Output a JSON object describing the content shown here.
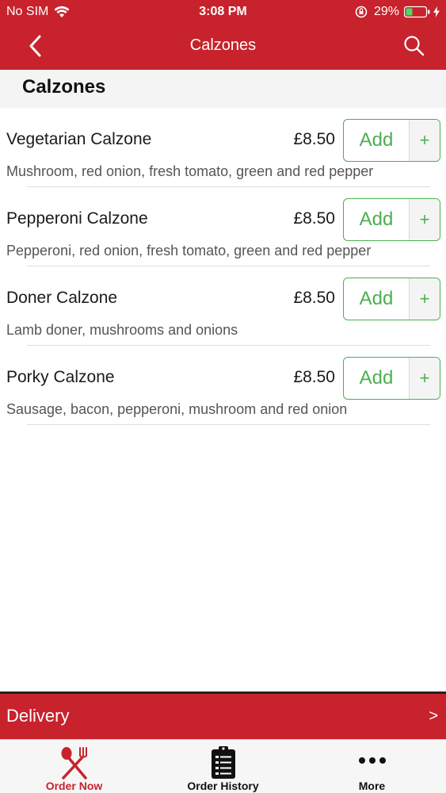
{
  "status_bar": {
    "carrier": "No SIM",
    "time": "3:08 PM",
    "battery": "29%"
  },
  "nav": {
    "title": "Calzones"
  },
  "section": {
    "title": "Calzones"
  },
  "items": [
    {
      "name": "Vegetarian Calzone",
      "price": "£8.50",
      "description": "Mushroom, red onion, fresh tomato, green and red pepper",
      "add_label": "Add",
      "plus_label": "+"
    },
    {
      "name": "Pepperoni Calzone",
      "price": "£8.50",
      "description": "Pepperoni, red onion, fresh tomato, green and red pepper",
      "add_label": "Add",
      "plus_label": "+"
    },
    {
      "name": "Doner Calzone",
      "price": "£8.50",
      "description": "Lamb doner, mushrooms and onions",
      "add_label": "Add",
      "plus_label": "+"
    },
    {
      "name": "Porky Calzone",
      "price": "£8.50",
      "description": "Sausage, bacon, pepperoni, mushroom and red onion",
      "add_label": "Add",
      "plus_label": "+"
    }
  ],
  "delivery": {
    "label": "Delivery",
    "arrow": ">"
  },
  "tabs": [
    {
      "label": "Order Now",
      "icon": "fork-knife-icon",
      "color": "#c8222c"
    },
    {
      "label": "Order History",
      "icon": "clipboard-list-icon",
      "color": "#111111"
    },
    {
      "label": "More",
      "icon": "more-dots-icon",
      "color": "#111111"
    }
  ],
  "colors": {
    "brand_red": "#c8222c",
    "add_green": "#4caf50"
  }
}
